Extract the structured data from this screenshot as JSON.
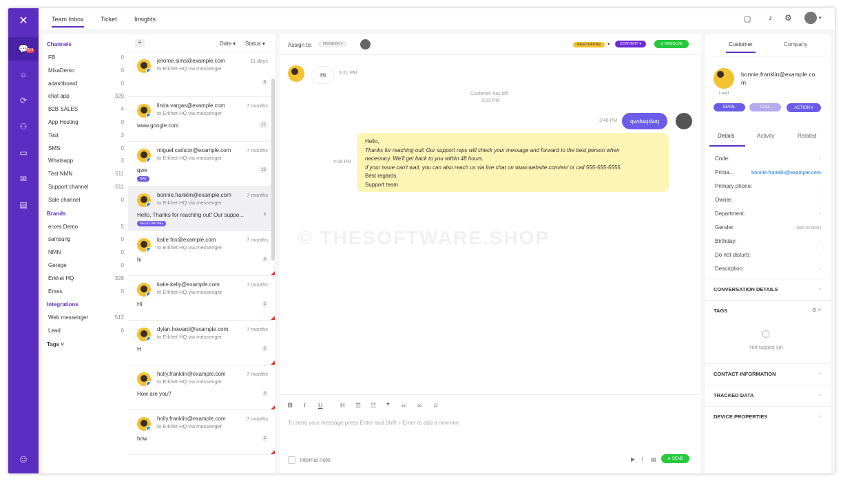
{
  "colors": {
    "brand": "#5b2ec1",
    "accent": "#6c5ce7",
    "resolve": "#27c93f",
    "negotiating": "#f2c230"
  },
  "nav_badge": "114",
  "tabs": [
    "Team Inbox",
    "Ticket",
    "Insights"
  ],
  "sidebar": {
    "channels_label": "Channels",
    "channels": [
      {
        "label": "FB",
        "count": "0"
      },
      {
        "label": "MixaDemo",
        "count": "0"
      },
      {
        "label": "adashboard",
        "count": "0"
      },
      {
        "label": "chat app",
        "count": "320"
      },
      {
        "label": "B2B SALES",
        "count": "4"
      },
      {
        "label": "App Hosting",
        "count": "0"
      },
      {
        "label": "Test",
        "count": "3"
      },
      {
        "label": "SMS",
        "count": "0"
      },
      {
        "label": "Whatsapp",
        "count": "3"
      },
      {
        "label": "Test NMN",
        "count": "511"
      },
      {
        "label": "Support channel",
        "count": "511"
      },
      {
        "label": "Sale channel",
        "count": "0"
      }
    ],
    "brands_label": "Brands",
    "brands": [
      {
        "label": "erxes Demo",
        "count": "5"
      },
      {
        "label": "samsung",
        "count": "0"
      },
      {
        "label": "NMN",
        "count": "0"
      },
      {
        "label": "Gerege",
        "count": "0"
      },
      {
        "label": "Erkhet HQ",
        "count": "328"
      },
      {
        "label": "Erxes",
        "count": "0"
      }
    ],
    "integrations_label": "Integrations",
    "integrations": [
      {
        "label": "Web messenger",
        "count": "512"
      },
      {
        "label": "Lead",
        "count": "0"
      }
    ],
    "tags_label": "Tags"
  },
  "list": {
    "date_label": "Date",
    "status_label": "Status",
    "items": [
      {
        "email": "jerome.sims@example.com",
        "sub": "to Erkhet HQ via messenger",
        "time": "11 days",
        "msg": "",
        "count": "9",
        "tag": ""
      },
      {
        "email": "linda.vargas@example.com",
        "sub": "to Erkhet HQ via messenger",
        "time": "7 months",
        "msg": "www.google.com",
        "count": "77",
        "tag": ""
      },
      {
        "email": "miguel.carlson@example.com",
        "sub": "to Erkhet HQ via messenger",
        "time": "7 months",
        "msg": "qwe",
        "count": "22",
        "tag": "SAV"
      },
      {
        "email": "bonnie.franklin@example.com",
        "sub": "to Erkhet HQ via messenger",
        "time": "7 months",
        "msg": "Hello, Thanks for reaching out! Our suppo...",
        "count": "4",
        "tag": "NEGOTIATING"
      },
      {
        "email": "katie.fox@example.com",
        "sub": "to Erkhet HQ via messenger",
        "time": "7 months",
        "msg": "hi",
        "count": "3",
        "tag": ""
      },
      {
        "email": "katie.kelly@example.com",
        "sub": "to Erkhet HQ via messenger",
        "time": "7 months",
        "msg": "Hi",
        "count": "2",
        "tag": ""
      },
      {
        "email": "dylan.howard@example.com",
        "sub": "to Erkhet HQ via messenger",
        "time": "7 months",
        "msg": "H",
        "count": "2",
        "tag": ""
      },
      {
        "email": "holly.franklin@example.com",
        "sub": "to Erkhet HQ via messenger",
        "time": "7 months",
        "msg": "How are you?",
        "count": "3",
        "tag": ""
      },
      {
        "email": "holly.franklin@example.com",
        "sub": "to Erkhet HQ via messenger",
        "time": "7 months",
        "msg": "how",
        "count": "2",
        "tag": ""
      }
    ]
  },
  "chat": {
    "assign_label": "Assign to:",
    "member_label": "MEMBER",
    "negotiating": "NEGOTIATING",
    "convert": "CONVERT",
    "resolve": "RESOLVE",
    "hi": "Hi",
    "hi_time": "3:21 PM",
    "left": "Customer has left",
    "left_time": "3:23 PM",
    "out_msg": "qwdwqdwq",
    "out_time": "3:46 PM",
    "reply_time": "4:39 PM",
    "reply_lines": [
      "Hello,",
      "Thanks for reaching out! Our support reps will check your message and forward to the best person when",
      "necessary. We'll get back to you within 48 hours.",
      "If your issue can't wait, you can also reach us via live chat on www.website.com/en/ or call 555-555-5555.",
      "Best regards,",
      "Support team"
    ],
    "placeholder": "To send your message press Enter and Shift + Enter to add a new line",
    "internal_note": "Internal note",
    "send": "SEND",
    "watermark": "© THESOFTWARE.SHOP"
  },
  "right": {
    "tabs": [
      "Customer",
      "Company"
    ],
    "email": "bonnie.franklin@example.co\nm",
    "role": "Lead",
    "email_btn": "EMAIL",
    "call_btn": "CALL",
    "action_btn": "ACTION",
    "subtabs": [
      "Details",
      "Activity",
      "Related"
    ],
    "fields": [
      {
        "k": "Code:",
        "v": "-"
      },
      {
        "k": "Prima...",
        "v": "bonnie.franklin@example.com"
      },
      {
        "k": "Primary phone:",
        "v": "-"
      },
      {
        "k": "Owner:",
        "v": "-"
      },
      {
        "k": "Department:",
        "v": "-"
      },
      {
        "k": "Gender:",
        "v": "Not known"
      },
      {
        "k": "Birthday:",
        "v": "-"
      },
      {
        "k": "Do not disturb:",
        "v": "-"
      },
      {
        "k": "Description:",
        "v": "-"
      }
    ],
    "sections": [
      "CONVERSATION DETAILS",
      "TAGS",
      "CONTACT INFORMATION",
      "TRACKED DATA",
      "DEVICE PROPERTIES"
    ],
    "not_tagged": "Not tagged yet"
  }
}
